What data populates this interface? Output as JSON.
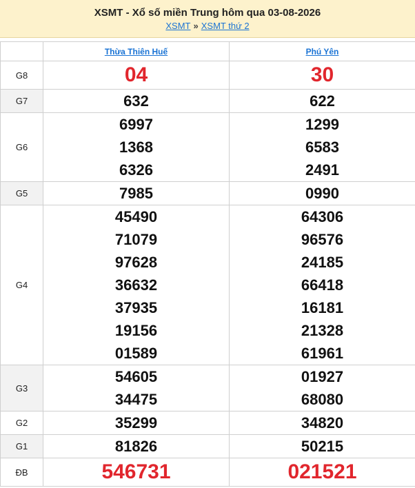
{
  "header": {
    "title": "XSMT - Xổ số miền Trung hôm qua 03-08-2026",
    "crumb1": "XSMT",
    "sep": "»",
    "crumb2": "XSMT thứ 2"
  },
  "columns": [
    "Thừa Thiên Huế",
    "Phú Yên"
  ],
  "prizes": [
    {
      "label": "G8",
      "c1": [
        "04"
      ],
      "c2": [
        "30"
      ]
    },
    {
      "label": "G7",
      "c1": [
        "632"
      ],
      "c2": [
        "622"
      ]
    },
    {
      "label": "G6",
      "c1": [
        "6997",
        "1368",
        "6326"
      ],
      "c2": [
        "1299",
        "6583",
        "2491"
      ]
    },
    {
      "label": "G5",
      "c1": [
        "7985"
      ],
      "c2": [
        "0990"
      ]
    },
    {
      "label": "G4",
      "c1": [
        "45490",
        "71079",
        "97628",
        "36632",
        "37935",
        "19156",
        "01589"
      ],
      "c2": [
        "64306",
        "96576",
        "24185",
        "66418",
        "16181",
        "21328",
        "61961"
      ]
    },
    {
      "label": "G3",
      "c1": [
        "54605",
        "34475"
      ],
      "c2": [
        "01927",
        "68080"
      ]
    },
    {
      "label": "G2",
      "c1": [
        "35299"
      ],
      "c2": [
        "34820"
      ]
    },
    {
      "label": "G1",
      "c1": [
        "81826"
      ],
      "c2": [
        "50215"
      ]
    },
    {
      "label": "ĐB",
      "c1": [
        "546731"
      ],
      "c2": [
        "021521"
      ]
    }
  ],
  "colors": {
    "accent_red": "#e1262d",
    "link_blue": "#1a73d4",
    "header_bg": "#fdf2cc"
  }
}
